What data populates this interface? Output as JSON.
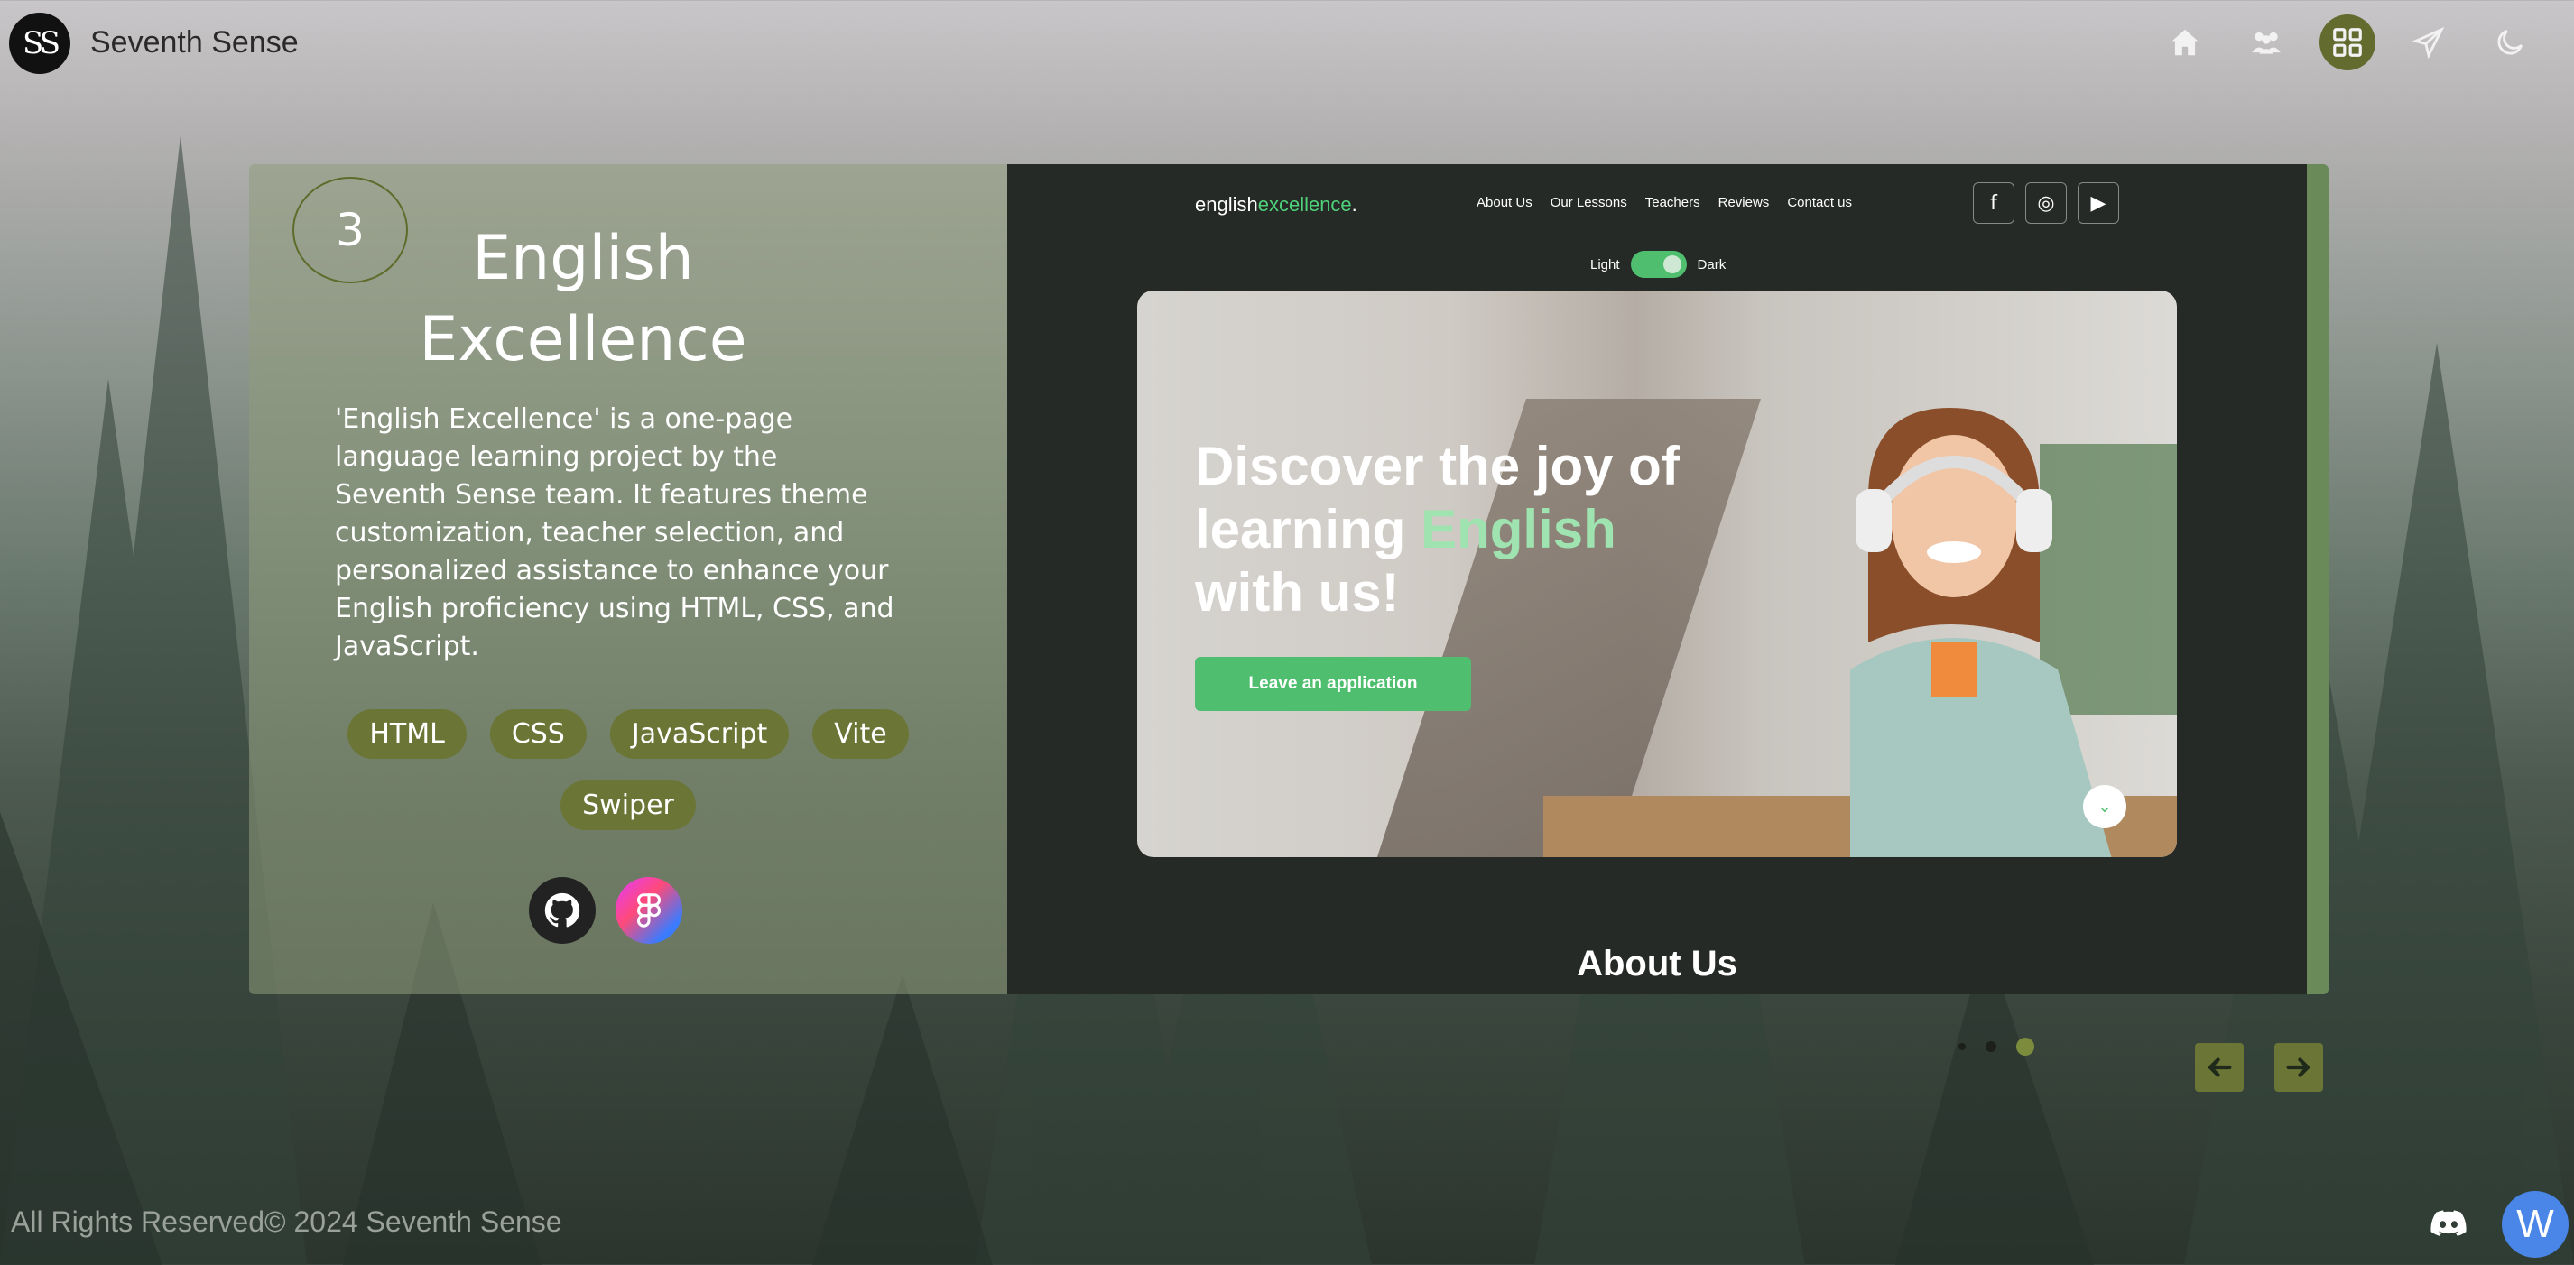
{
  "header": {
    "logo_text": "SS",
    "brand": "Seventh Sense",
    "nav": [
      {
        "icon": "home-icon"
      },
      {
        "icon": "team-icon"
      },
      {
        "icon": "grid-icon",
        "active": true
      },
      {
        "icon": "send-icon"
      },
      {
        "icon": "moon-icon"
      }
    ]
  },
  "project": {
    "number": "3",
    "title": "English Excellence",
    "description": "'English Excellence' is a one-page language learning project by the Seventh Sense team. It features theme customization, teacher selection, and personalized assistance to enhance your English proficiency using HTML, CSS, and JavaScript.",
    "tags": [
      "HTML",
      "CSS",
      "JavaScript",
      "Vite",
      "Swiper"
    ],
    "links": [
      {
        "icon": "github-icon"
      },
      {
        "icon": "figma-icon"
      }
    ]
  },
  "preview": {
    "logo_main": "english",
    "logo_accent": "excellence",
    "logo_dot": ".",
    "menu": [
      "About Us",
      "Our Lessons",
      "Teachers",
      "Reviews",
      "Contact us"
    ],
    "social": [
      "f",
      "◎",
      "▶"
    ],
    "theme_light": "Light",
    "theme_dark": "Dark",
    "hero_line1": "Discover the joy of",
    "hero_line2_a": "learning ",
    "hero_line2_b": "English",
    "hero_line3": "with us!",
    "hero_button": "Leave an application",
    "section_title": "About Us"
  },
  "pagination": {
    "total": 3,
    "active": 3
  },
  "footer": {
    "copyright": "All Rights Reserved© 2024 Seventh Sense",
    "avatar_letter": "W"
  },
  "colors": {
    "accent": "#636b2f",
    "preview_green": "#4fbf6f",
    "preview_bg": "#262a26"
  }
}
